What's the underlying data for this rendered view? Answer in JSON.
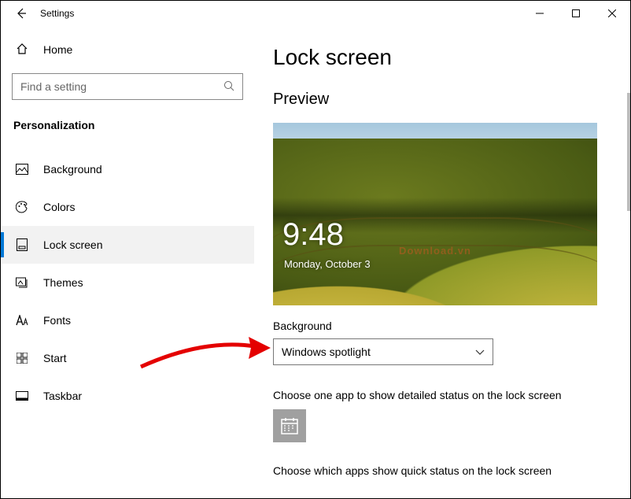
{
  "titlebar": {
    "title": "Settings"
  },
  "sidebar": {
    "home": "Home",
    "search_placeholder": "Find a setting",
    "category": "Personalization",
    "items": [
      {
        "label": "Background"
      },
      {
        "label": "Colors"
      },
      {
        "label": "Lock screen"
      },
      {
        "label": "Themes"
      },
      {
        "label": "Fonts"
      },
      {
        "label": "Start"
      },
      {
        "label": "Taskbar"
      }
    ]
  },
  "main": {
    "heading": "Lock screen",
    "preview_label": "Preview",
    "preview": {
      "time": "9:48",
      "date": "Monday, October 3",
      "watermark": "Download.vn"
    },
    "background_label": "Background",
    "background_value": "Windows spotlight",
    "detailed_status_label": "Choose one app to show detailed status on the lock screen",
    "quick_status_label": "Choose which apps show quick status on the lock screen"
  }
}
